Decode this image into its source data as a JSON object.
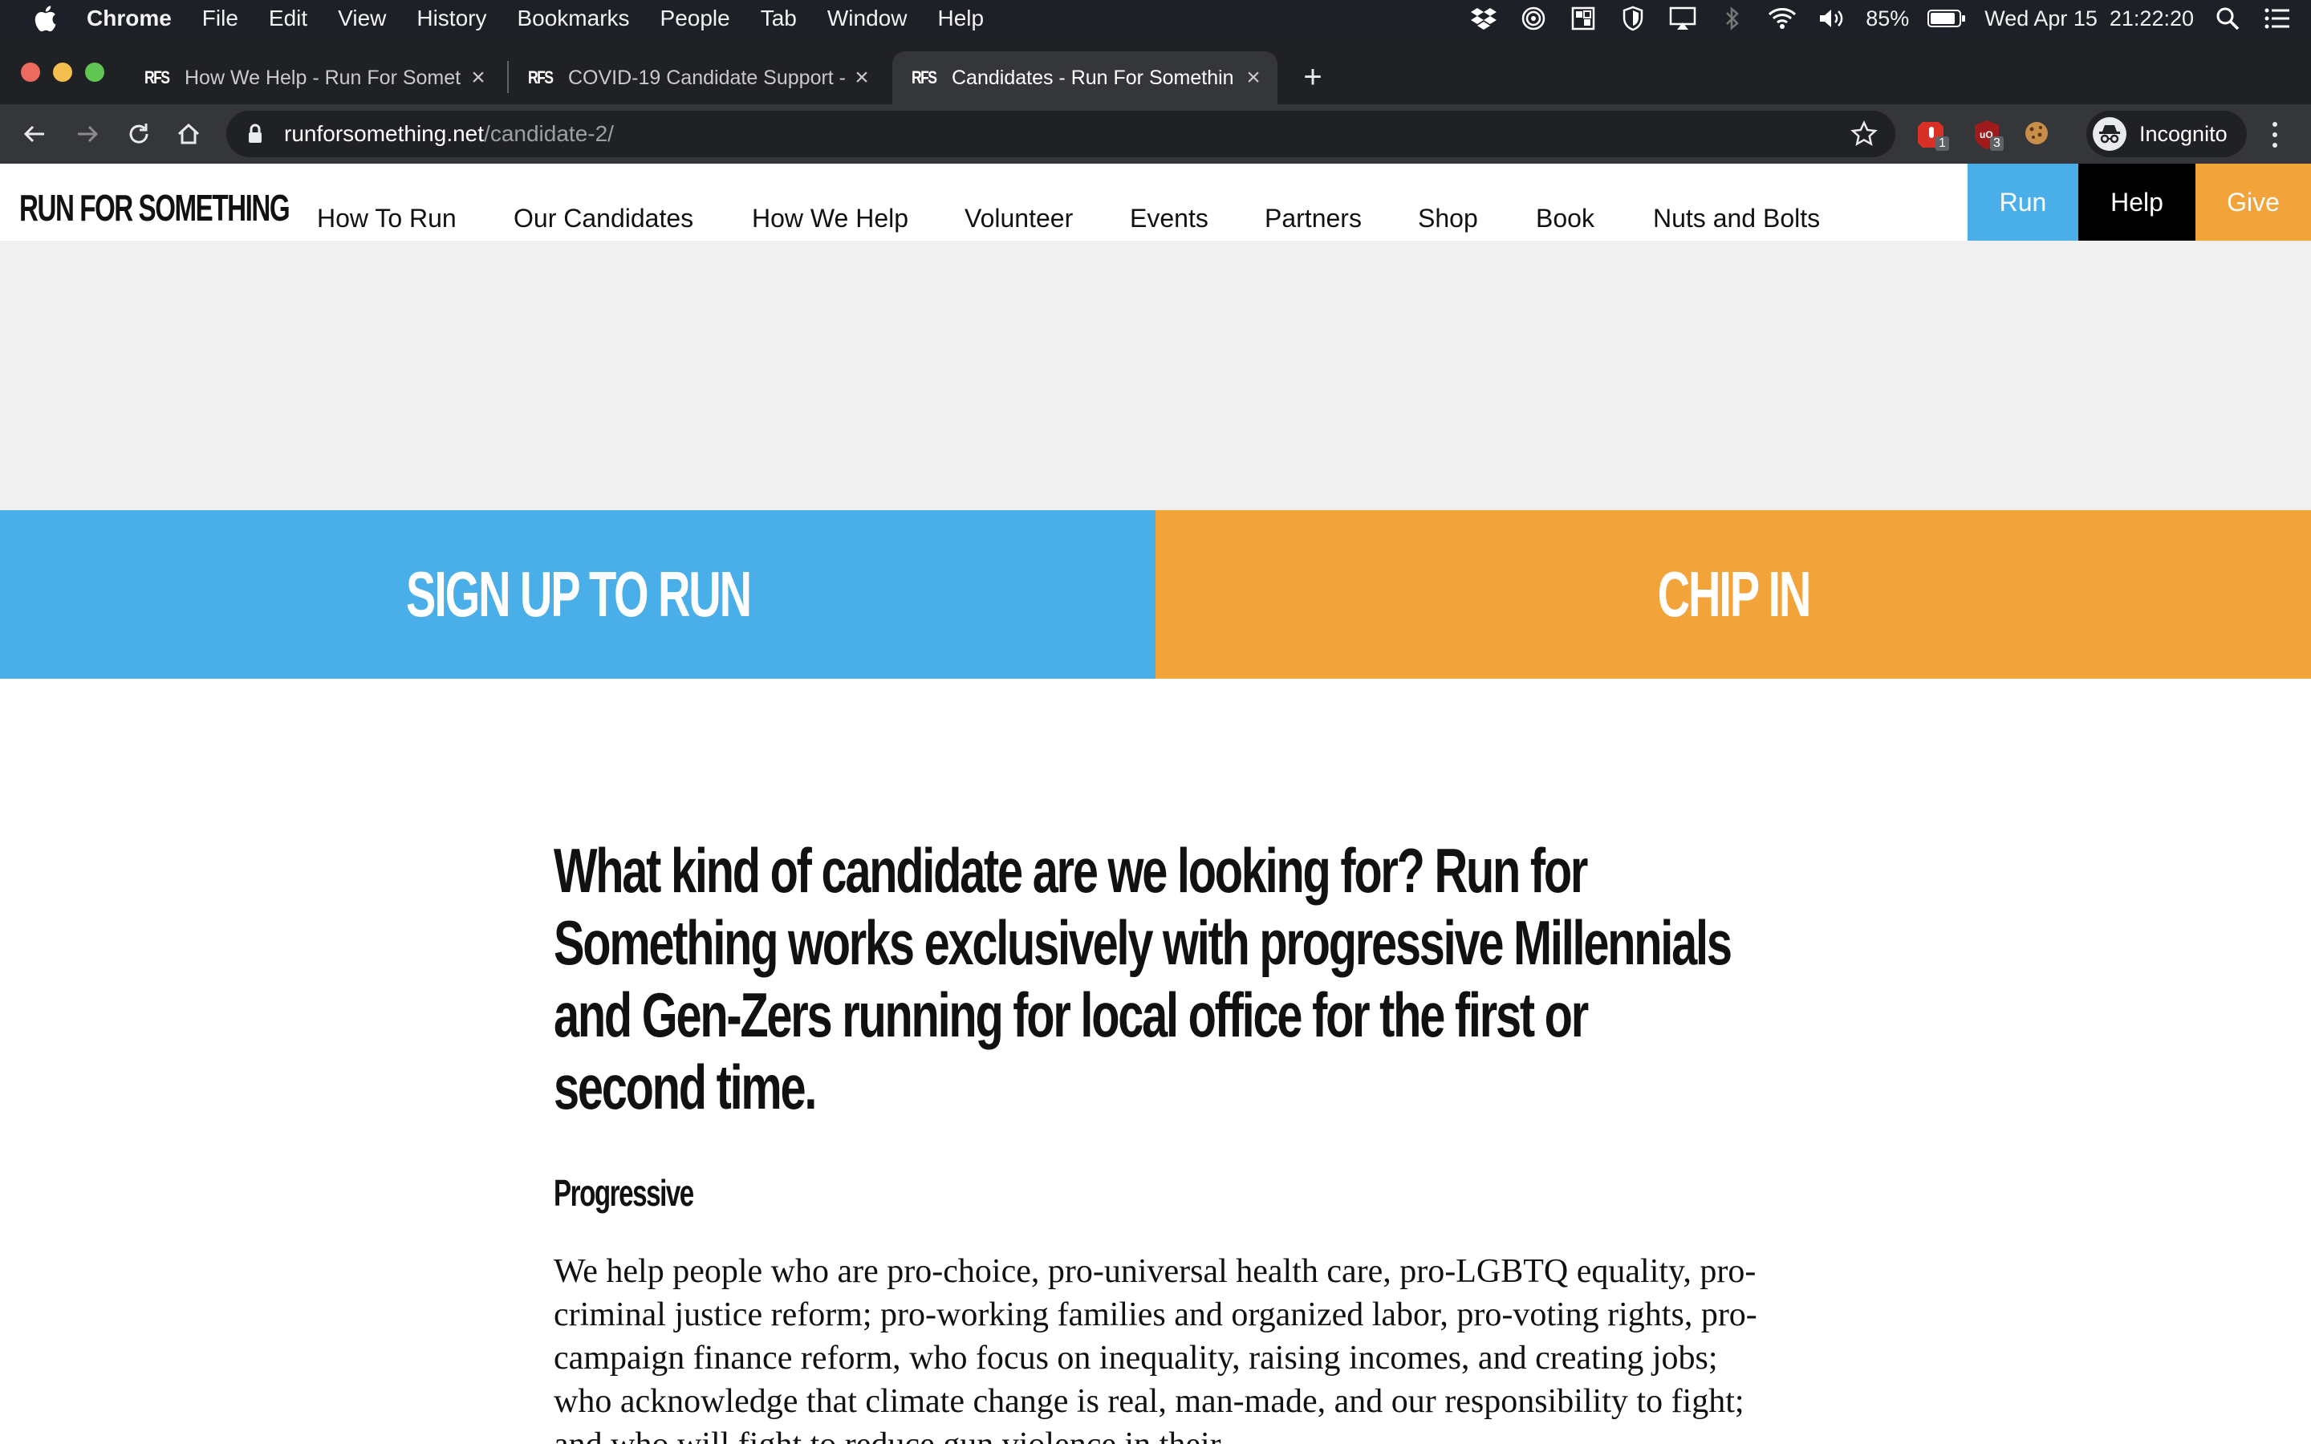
{
  "menubar": {
    "app": "Chrome",
    "items": [
      "File",
      "Edit",
      "View",
      "History",
      "Bookmarks",
      "People",
      "Tab",
      "Window",
      "Help"
    ],
    "battery": "85%",
    "datetime": "Wed Apr 15  21:22:20"
  },
  "tabs": [
    {
      "favicon": "RFS",
      "title": "How We Help - Run For Somet"
    },
    {
      "favicon": "RFS",
      "title": "COVID-19 Candidate Support -"
    },
    {
      "favicon": "RFS",
      "title": "Candidates - Run For Somethin"
    }
  ],
  "address": {
    "domain": "runforsomething.net",
    "path": "/candidate-2/"
  },
  "extensions": {
    "badge_1": "1",
    "badge_2": "3"
  },
  "incognito_label": "Incognito",
  "site": {
    "logo": "RUN FOR SOMETHING",
    "nav": [
      "How To Run",
      "Our Candidates",
      "How We Help",
      "Volunteer",
      "Events",
      "Partners",
      "Shop",
      "Book",
      "Nuts and Bolts"
    ],
    "cta_run": "Run",
    "cta_help": "Help",
    "cta_give": "Give",
    "colors": {
      "blue": "#4aaee8",
      "orange": "#f2a33a",
      "black": "#000000"
    }
  },
  "bands": {
    "left": "SIGN UP TO RUN",
    "right": "CHIP IN"
  },
  "content": {
    "headline": "What kind of candidate are we looking for? Run for Something works exclusively with progressive Millennials and Gen-Zers running for local office for the first or second time.",
    "subhead": "Progressive",
    "body": "We help people who are pro-choice, pro-universal health care, pro-LGBTQ equality, pro-criminal justice reform; pro-working families and organized labor, pro-voting rights, pro-campaign finance reform, who focus on inequality, raising incomes, and creating jobs; who acknowledge that climate change is real, man-made, and our responsibility to fight; and who will fight to reduce gun violence in their"
  }
}
